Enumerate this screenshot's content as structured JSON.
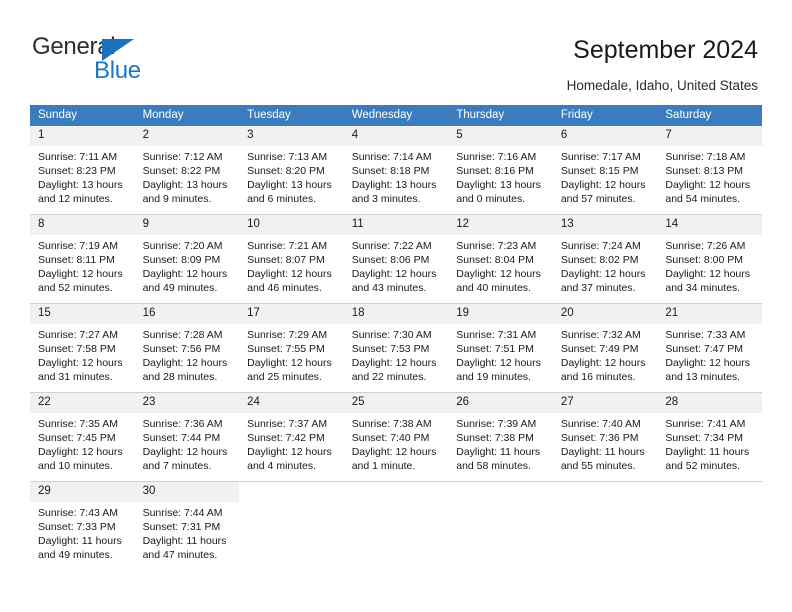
{
  "brand": {
    "name_part1": "General",
    "name_part2": "Blue",
    "triangle_color": "#1d71b8",
    "blue_color": "#1878c8"
  },
  "header": {
    "title": "September 2024",
    "subtitle": "Homedale, Idaho, United States"
  },
  "theme": {
    "header_bg": "#3a7cbe",
    "header_text": "#ffffff",
    "daynum_bg": "#f1f1f1",
    "grid_line": "#cfcfcf"
  },
  "weekdays": [
    "Sunday",
    "Monday",
    "Tuesday",
    "Wednesday",
    "Thursday",
    "Friday",
    "Saturday"
  ],
  "labels": {
    "sunrise_prefix": "Sunrise:",
    "sunset_prefix": "Sunset:",
    "daylight_prefix": "Daylight:"
  },
  "weeks": [
    [
      {
        "day": "1",
        "sunrise": "Sunrise: 7:11 AM",
        "sunset": "Sunset: 8:23 PM",
        "daylight_l1": "Daylight: 13 hours",
        "daylight_l2": "and 12 minutes."
      },
      {
        "day": "2",
        "sunrise": "Sunrise: 7:12 AM",
        "sunset": "Sunset: 8:22 PM",
        "daylight_l1": "Daylight: 13 hours",
        "daylight_l2": "and 9 minutes."
      },
      {
        "day": "3",
        "sunrise": "Sunrise: 7:13 AM",
        "sunset": "Sunset: 8:20 PM",
        "daylight_l1": "Daylight: 13 hours",
        "daylight_l2": "and 6 minutes."
      },
      {
        "day": "4",
        "sunrise": "Sunrise: 7:14 AM",
        "sunset": "Sunset: 8:18 PM",
        "daylight_l1": "Daylight: 13 hours",
        "daylight_l2": "and 3 minutes."
      },
      {
        "day": "5",
        "sunrise": "Sunrise: 7:16 AM",
        "sunset": "Sunset: 8:16 PM",
        "daylight_l1": "Daylight: 13 hours",
        "daylight_l2": "and 0 minutes."
      },
      {
        "day": "6",
        "sunrise": "Sunrise: 7:17 AM",
        "sunset": "Sunset: 8:15 PM",
        "daylight_l1": "Daylight: 12 hours",
        "daylight_l2": "and 57 minutes."
      },
      {
        "day": "7",
        "sunrise": "Sunrise: 7:18 AM",
        "sunset": "Sunset: 8:13 PM",
        "daylight_l1": "Daylight: 12 hours",
        "daylight_l2": "and 54 minutes."
      }
    ],
    [
      {
        "day": "8",
        "sunrise": "Sunrise: 7:19 AM",
        "sunset": "Sunset: 8:11 PM",
        "daylight_l1": "Daylight: 12 hours",
        "daylight_l2": "and 52 minutes."
      },
      {
        "day": "9",
        "sunrise": "Sunrise: 7:20 AM",
        "sunset": "Sunset: 8:09 PM",
        "daylight_l1": "Daylight: 12 hours",
        "daylight_l2": "and 49 minutes."
      },
      {
        "day": "10",
        "sunrise": "Sunrise: 7:21 AM",
        "sunset": "Sunset: 8:07 PM",
        "daylight_l1": "Daylight: 12 hours",
        "daylight_l2": "and 46 minutes."
      },
      {
        "day": "11",
        "sunrise": "Sunrise: 7:22 AM",
        "sunset": "Sunset: 8:06 PM",
        "daylight_l1": "Daylight: 12 hours",
        "daylight_l2": "and 43 minutes."
      },
      {
        "day": "12",
        "sunrise": "Sunrise: 7:23 AM",
        "sunset": "Sunset: 8:04 PM",
        "daylight_l1": "Daylight: 12 hours",
        "daylight_l2": "and 40 minutes."
      },
      {
        "day": "13",
        "sunrise": "Sunrise: 7:24 AM",
        "sunset": "Sunset: 8:02 PM",
        "daylight_l1": "Daylight: 12 hours",
        "daylight_l2": "and 37 minutes."
      },
      {
        "day": "14",
        "sunrise": "Sunrise: 7:26 AM",
        "sunset": "Sunset: 8:00 PM",
        "daylight_l1": "Daylight: 12 hours",
        "daylight_l2": "and 34 minutes."
      }
    ],
    [
      {
        "day": "15",
        "sunrise": "Sunrise: 7:27 AM",
        "sunset": "Sunset: 7:58 PM",
        "daylight_l1": "Daylight: 12 hours",
        "daylight_l2": "and 31 minutes."
      },
      {
        "day": "16",
        "sunrise": "Sunrise: 7:28 AM",
        "sunset": "Sunset: 7:56 PM",
        "daylight_l1": "Daylight: 12 hours",
        "daylight_l2": "and 28 minutes."
      },
      {
        "day": "17",
        "sunrise": "Sunrise: 7:29 AM",
        "sunset": "Sunset: 7:55 PM",
        "daylight_l1": "Daylight: 12 hours",
        "daylight_l2": "and 25 minutes."
      },
      {
        "day": "18",
        "sunrise": "Sunrise: 7:30 AM",
        "sunset": "Sunset: 7:53 PM",
        "daylight_l1": "Daylight: 12 hours",
        "daylight_l2": "and 22 minutes."
      },
      {
        "day": "19",
        "sunrise": "Sunrise: 7:31 AM",
        "sunset": "Sunset: 7:51 PM",
        "daylight_l1": "Daylight: 12 hours",
        "daylight_l2": "and 19 minutes."
      },
      {
        "day": "20",
        "sunrise": "Sunrise: 7:32 AM",
        "sunset": "Sunset: 7:49 PM",
        "daylight_l1": "Daylight: 12 hours",
        "daylight_l2": "and 16 minutes."
      },
      {
        "day": "21",
        "sunrise": "Sunrise: 7:33 AM",
        "sunset": "Sunset: 7:47 PM",
        "daylight_l1": "Daylight: 12 hours",
        "daylight_l2": "and 13 minutes."
      }
    ],
    [
      {
        "day": "22",
        "sunrise": "Sunrise: 7:35 AM",
        "sunset": "Sunset: 7:45 PM",
        "daylight_l1": "Daylight: 12 hours",
        "daylight_l2": "and 10 minutes."
      },
      {
        "day": "23",
        "sunrise": "Sunrise: 7:36 AM",
        "sunset": "Sunset: 7:44 PM",
        "daylight_l1": "Daylight: 12 hours",
        "daylight_l2": "and 7 minutes."
      },
      {
        "day": "24",
        "sunrise": "Sunrise: 7:37 AM",
        "sunset": "Sunset: 7:42 PM",
        "daylight_l1": "Daylight: 12 hours",
        "daylight_l2": "and 4 minutes."
      },
      {
        "day": "25",
        "sunrise": "Sunrise: 7:38 AM",
        "sunset": "Sunset: 7:40 PM",
        "daylight_l1": "Daylight: 12 hours",
        "daylight_l2": "and 1 minute."
      },
      {
        "day": "26",
        "sunrise": "Sunrise: 7:39 AM",
        "sunset": "Sunset: 7:38 PM",
        "daylight_l1": "Daylight: 11 hours",
        "daylight_l2": "and 58 minutes."
      },
      {
        "day": "27",
        "sunrise": "Sunrise: 7:40 AM",
        "sunset": "Sunset: 7:36 PM",
        "daylight_l1": "Daylight: 11 hours",
        "daylight_l2": "and 55 minutes."
      },
      {
        "day": "28",
        "sunrise": "Sunrise: 7:41 AM",
        "sunset": "Sunset: 7:34 PM",
        "daylight_l1": "Daylight: 11 hours",
        "daylight_l2": "and 52 minutes."
      }
    ],
    [
      {
        "day": "29",
        "sunrise": "Sunrise: 7:43 AM",
        "sunset": "Sunset: 7:33 PM",
        "daylight_l1": "Daylight: 11 hours",
        "daylight_l2": "and 49 minutes."
      },
      {
        "day": "30",
        "sunrise": "Sunrise: 7:44 AM",
        "sunset": "Sunset: 7:31 PM",
        "daylight_l1": "Daylight: 11 hours",
        "daylight_l2": "and 47 minutes."
      },
      {
        "day": "",
        "sunrise": "",
        "sunset": "",
        "daylight_l1": "",
        "daylight_l2": ""
      },
      {
        "day": "",
        "sunrise": "",
        "sunset": "",
        "daylight_l1": "",
        "daylight_l2": ""
      },
      {
        "day": "",
        "sunrise": "",
        "sunset": "",
        "daylight_l1": "",
        "daylight_l2": ""
      },
      {
        "day": "",
        "sunrise": "",
        "sunset": "",
        "daylight_l1": "",
        "daylight_l2": ""
      },
      {
        "day": "",
        "sunrise": "",
        "sunset": "",
        "daylight_l1": "",
        "daylight_l2": ""
      }
    ]
  ]
}
